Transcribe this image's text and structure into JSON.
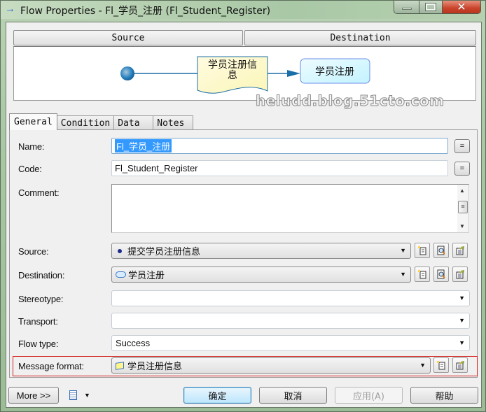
{
  "window": {
    "title": "Flow Properties - Fl_学员_注册 (Fl_Student_Register)",
    "title_icon": "arrow-right-icon",
    "controls": [
      "minimize",
      "maximize",
      "close"
    ],
    "close_glyph": "✕"
  },
  "header": {
    "source_label": "Source",
    "destination_label": "Destination"
  },
  "diagram": {
    "source_node": "start-node",
    "flow_object_label": "学员注册信息",
    "destination_label": "学员注册",
    "colors": {
      "node_blue": "#1f7fbf",
      "line": "#1b6fa8",
      "doc_fill": "#fffbd0",
      "activity_fill": "#ccf6ff",
      "activity_border": "#6b8be8"
    }
  },
  "watermark": "heludd.blog.51cto.com",
  "tabs": [
    {
      "label": "General",
      "active": true
    },
    {
      "label": "Condition",
      "active": false
    },
    {
      "label": "Data",
      "active": false
    },
    {
      "label": "Notes",
      "active": false
    }
  ],
  "form": {
    "name": {
      "label": "Name:",
      "value": "Fl_学员_注册",
      "button": "="
    },
    "code": {
      "label": "Code:",
      "value": "Fl_Student_Register",
      "button": "="
    },
    "comment": {
      "label": "Comment:",
      "value": ""
    },
    "source": {
      "label": "Source:",
      "value": "提交学员注册信息",
      "icon": "start-dot-icon"
    },
    "destination": {
      "label": "Destination:",
      "value": "学员注册",
      "icon": "activity-pill-icon"
    },
    "stereotype": {
      "label": "Stereotype:",
      "value": ""
    },
    "transport": {
      "label": "Transport:",
      "value": ""
    },
    "flow_type": {
      "label": "Flow type:",
      "value": "Success"
    },
    "message_format": {
      "label": "Message format:",
      "value": "学员注册信息",
      "icon": "message-format-icon",
      "highlight_color": "#d41e1e"
    }
  },
  "footer": {
    "more": "More >>",
    "ok": "确定",
    "cancel": "取消",
    "apply": "应用(A)",
    "help": "帮助"
  }
}
